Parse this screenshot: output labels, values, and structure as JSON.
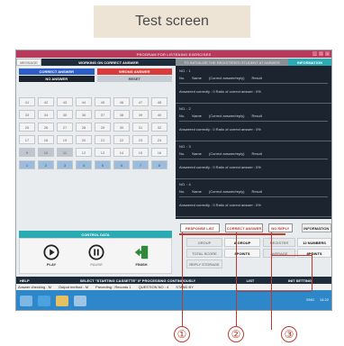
{
  "header": {
    "title": "Test screen"
  },
  "window": {
    "title": "PROGRAM FOR LISTENING EXERCISES",
    "controls": [
      "_",
      "□",
      "×"
    ]
  },
  "message": {
    "label": "MESSAGE",
    "text": "WORKING ON CORRECT ANSWER"
  },
  "answers": {
    "correct": "CORRECT ANSWER",
    "wrong": "WRONG ANSWER",
    "no_answer": "NO ANSWER",
    "reset": "RESET"
  },
  "grid": {
    "rows": [
      [
        "41",
        "42",
        "43",
        "44",
        "45",
        "46",
        "47",
        "48"
      ],
      [
        "33",
        "34",
        "35",
        "36",
        "37",
        "38",
        "39",
        "40"
      ],
      [
        "25",
        "26",
        "27",
        "28",
        "29",
        "30",
        "31",
        "32"
      ],
      [
        "17",
        "18",
        "19",
        "20",
        "21",
        "22",
        "23",
        "24"
      ],
      [
        "9",
        "10",
        "11",
        "12",
        "13",
        "14",
        "15",
        "16"
      ],
      [
        "1",
        "2",
        "3",
        "4",
        "5",
        "6",
        "7",
        "8"
      ]
    ]
  },
  "control": {
    "header": "CONTROL DATA",
    "play": "PLAY",
    "pause": "PAUSE",
    "finish": "FINISH"
  },
  "panel": {
    "tab_main": "TO INITIALIZE THE REGISTERED STUDENT AT ANSWER",
    "tab_info": "INFORMATION",
    "entries": [
      {
        "no": "NO. : 1",
        "col_no": "No.",
        "col_name": "Name",
        "col_ans": "(Correct answer/reply)",
        "col_result": "Result",
        "stats": "Answered correctly : 0    Ratio of correct answer : 0%"
      },
      {
        "no": "NO. : 2",
        "col_no": "No.",
        "col_name": "Name",
        "col_ans": "(Correct answer/reply)",
        "col_result": "Result",
        "stats": "Answered correctly : 0    Ratio of correct answer : 0%"
      },
      {
        "no": "NO. : 3",
        "col_no": "No.",
        "col_name": "Name",
        "col_ans": "(Correct answer/reply)",
        "col_result": "Result",
        "stats": "Answered correctly : 0    Ratio of correct answer : 0%"
      },
      {
        "no": "NO. : 4",
        "col_no": "No.",
        "col_name": "Name",
        "col_ans": "(Correct answer/reply)",
        "col_result": "Result",
        "stats": "Answered correctly : 0    Ratio of correct answer : 0%"
      }
    ]
  },
  "tabs": {
    "response_list": "RESPONSE LIST",
    "correct_answer": "CORRECT ANSWER",
    "no_reply": "NO REPLY",
    "information": "INFORMATION"
  },
  "options": {
    "group": "GROUP",
    "a_group": "A GROUP",
    "register": "REGISTER",
    "numbers12": "12 NUMBERS",
    "total_score": "TOTAL SCORE",
    "points8a": "8POINTS",
    "average": "AVERAGE",
    "points8b": "8POINTS",
    "reply_storage": "REPLY STORAGE"
  },
  "helpbar": {
    "help": "HELP",
    "instruction": "SELECT \"STARTING CASSETTE\" IF PROCESSING CONTINUOUSLY",
    "list": "LIST",
    "setting": "INIT SETTING"
  },
  "statusbar": {
    "s1": "Answer checking : M",
    "s2": "Output method : M",
    "s3": "Preceding : Records 1",
    "s4": "QUESTION NO : 4",
    "s5": "STAND BY"
  },
  "taskbar": {
    "lang": "ENG",
    "time": "14:22"
  },
  "callouts": [
    "①",
    "②",
    "③"
  ],
  "colors": {
    "accent": "#2aaab2",
    "dark": "#1c2430",
    "callout": "#c0392b",
    "titlebar": "#b83a5b"
  }
}
